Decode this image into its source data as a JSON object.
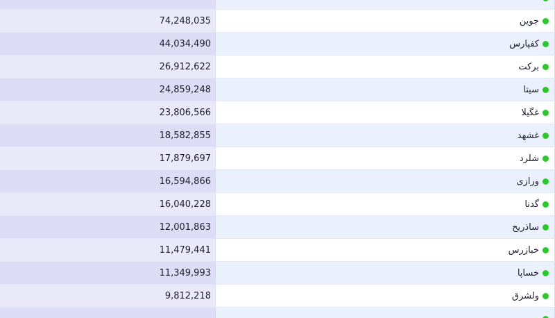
{
  "colors": {
    "status_dot": "#2bc82b"
  },
  "rows": [
    {
      "name": "",
      "value": ""
    },
    {
      "name": "جوین",
      "value": "74,248,035"
    },
    {
      "name": "کفپارس",
      "value": "44,034,490"
    },
    {
      "name": "برکت",
      "value": "26,912,622"
    },
    {
      "name": "سیتا",
      "value": "24,859,248"
    },
    {
      "name": "غگیلا",
      "value": "23,806,566"
    },
    {
      "name": "غشهد",
      "value": "18,582,855"
    },
    {
      "name": "شلرد",
      "value": "17,879,697"
    },
    {
      "name": "ورازی",
      "value": "16,594,866"
    },
    {
      "name": "گدنا",
      "value": "16,040,228"
    },
    {
      "name": "ساذریح",
      "value": "12,001,863"
    },
    {
      "name": "خبازرس",
      "value": "11,479,441"
    },
    {
      "name": "خساپا",
      "value": "11,349,993"
    },
    {
      "name": "ولشرق",
      "value": "9,812,218"
    },
    {
      "name": "",
      "value": ""
    }
  ]
}
